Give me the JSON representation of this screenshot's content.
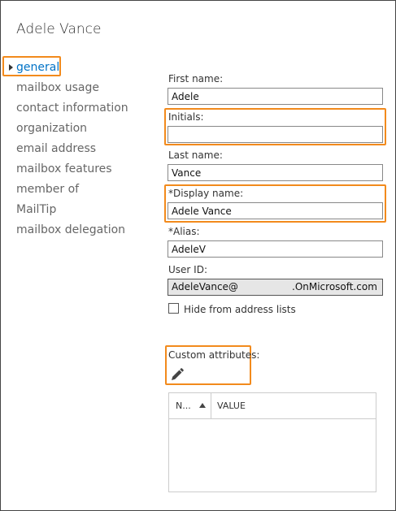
{
  "header": {
    "title": "Adele Vance"
  },
  "nav": {
    "items": [
      {
        "label": "general"
      },
      {
        "label": "mailbox usage"
      },
      {
        "label": "contact information"
      },
      {
        "label": "organization"
      },
      {
        "label": "email address"
      },
      {
        "label": "mailbox features"
      },
      {
        "label": "member of"
      },
      {
        "label": "MailTip"
      },
      {
        "label": "mailbox delegation"
      }
    ]
  },
  "form": {
    "first_name": {
      "label": "First name:",
      "value": "Adele"
    },
    "initials": {
      "label": "Initials:",
      "value": ""
    },
    "last_name": {
      "label": "Last name:",
      "value": "Vance"
    },
    "display_name": {
      "label": "*Display name:",
      "value": "Adele Vance"
    },
    "alias": {
      "label": "*Alias:",
      "value": "AdeleV"
    },
    "user_id": {
      "label": "User ID:",
      "local": "AdeleVance@",
      "domain": ".OnMicrosoft.com"
    },
    "hide_from_lists": {
      "label": "Hide from address lists",
      "checked": false
    },
    "custom_attributes": {
      "label": "Custom attributes:",
      "icon": "pencil-icon"
    }
  },
  "attributes_table": {
    "columns": [
      "N...",
      "VALUE"
    ],
    "sort_icon": "sort-ascending-icon",
    "rows": []
  },
  "colors": {
    "highlight": "#f28a1c",
    "active_nav": "#0072c6"
  }
}
